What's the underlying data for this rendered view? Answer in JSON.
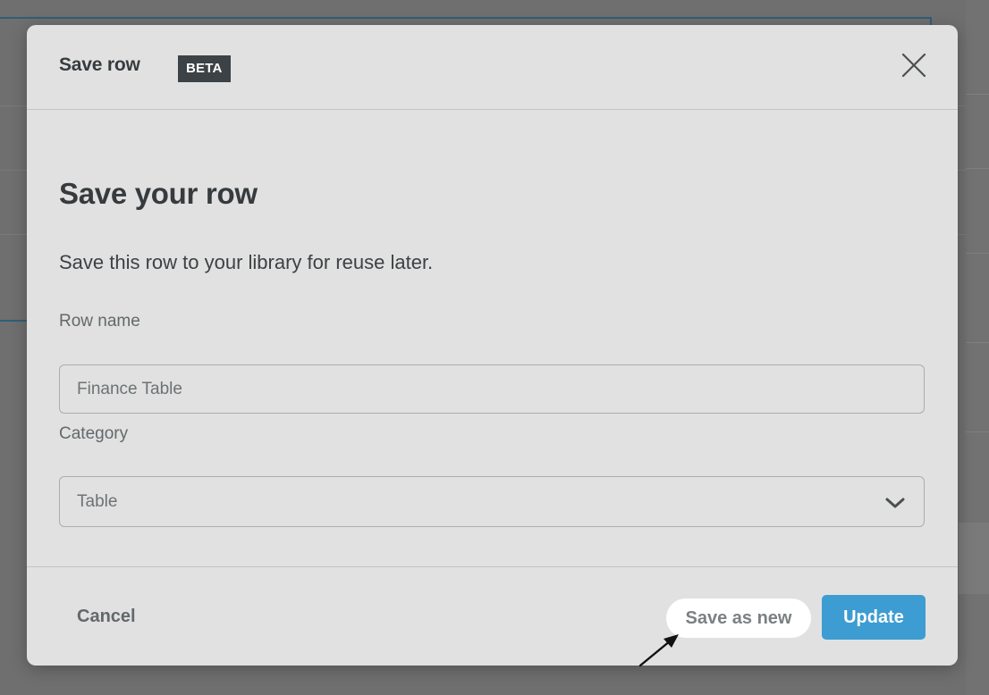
{
  "modal": {
    "title": "Save row",
    "badge": "BETA",
    "close_icon": "close-icon",
    "heading": "Save your row",
    "description": "Save this row to your library for reuse later.",
    "fields": {
      "row_name": {
        "label": "Row name",
        "placeholder": "Finance Table"
      },
      "category": {
        "label": "Category",
        "selected": "Table",
        "icon": "chevron-down-icon"
      }
    },
    "footer": {
      "cancel_label": "Cancel",
      "save_as_new_label": "Save as new",
      "update_label": "Update"
    }
  },
  "colors": {
    "accent": "#3d9cd2",
    "modal_background": "#e1e1e1",
    "badge_background": "#3c4245",
    "backdrop": "#6f6f6f"
  },
  "annotation": {
    "icon": "arrow-pointer-icon"
  }
}
